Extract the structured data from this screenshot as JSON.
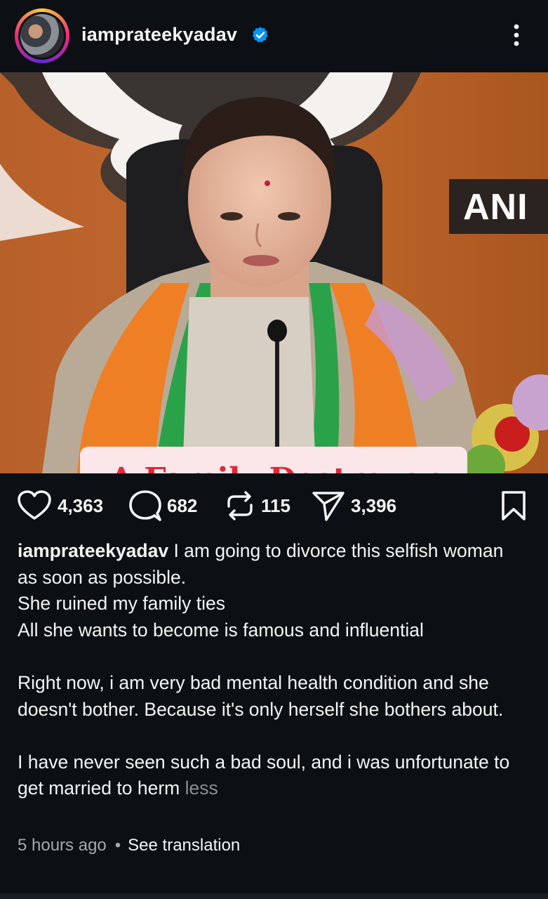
{
  "post": {
    "username": "iamprateekyadav",
    "verified": true
  },
  "image": {
    "overlay_text": "A Family Destroyer",
    "corner_tag": "ANI"
  },
  "actions": {
    "likes": "4,363",
    "comments": "682",
    "reposts": "115",
    "shares": "3,396"
  },
  "caption": {
    "username": "iamprateekyadav",
    "line1": " I am going to divorce this selfish woman as soon as possible.",
    "line2": "She ruined my family ties",
    "line3": "All she wants to become is famous and influential",
    "para2": "Right now, i am very bad mental health condition and she doesn't bother. Because it's only herself she bothers about.",
    "para3": "I have never seen such a bad soul, and i was unfortunate to get married to herm",
    "less_label": "less"
  },
  "meta": {
    "timestamp": "5 hours ago",
    "separator": "•",
    "translate_label": "See translation"
  },
  "icons": {
    "like": "heart-icon",
    "comment": "comment-icon",
    "repost": "repost-icon",
    "share": "share-icon",
    "save": "bookmark-icon",
    "more": "more-vertical-icon",
    "verified": "verified-badge-icon"
  },
  "colors": {
    "background": "#0c1014",
    "overlay_text": "#e0283a",
    "overlay_bg": "#fbe7e9",
    "verified": "#0095f6"
  }
}
